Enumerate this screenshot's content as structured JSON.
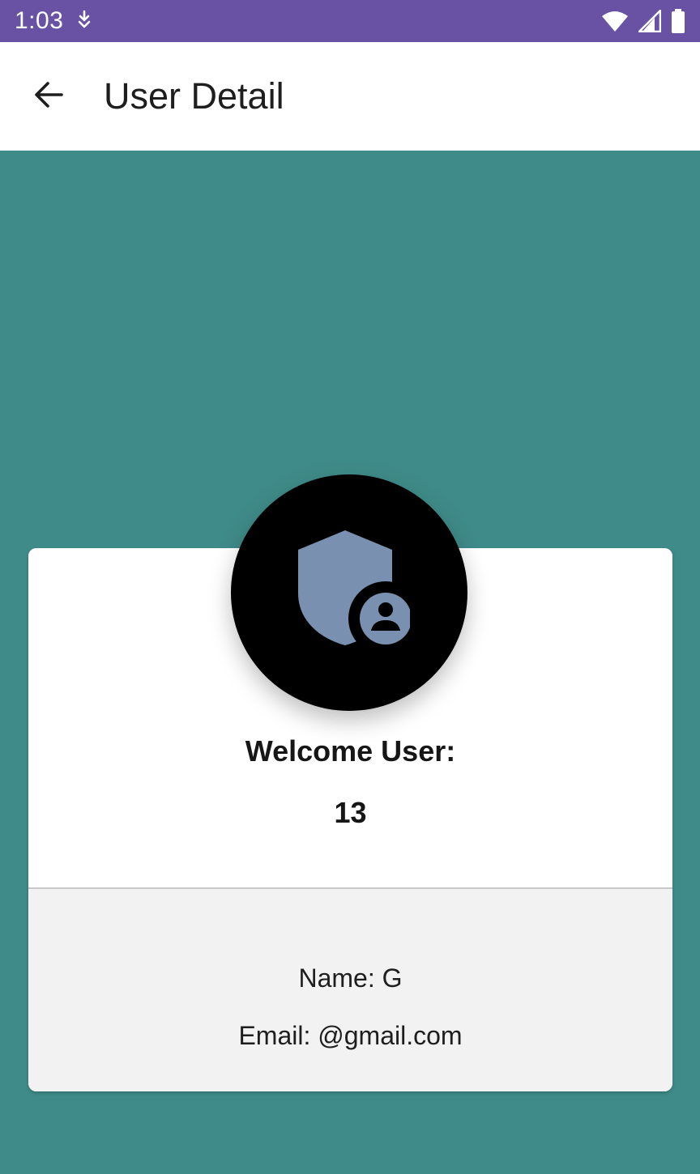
{
  "status_bar": {
    "time": "1:03",
    "background_color": "#6952a3",
    "icons": [
      "download-notification-icon",
      "wifi-icon",
      "cell-signal-icon",
      "battery-icon"
    ]
  },
  "app_bar": {
    "title": "User Detail",
    "back_icon": "arrow-back-icon"
  },
  "colors": {
    "page_background": "#3f8b89",
    "avatar_background": "#000000",
    "avatar_icon": "#7a90b0",
    "card_bottom": "#f2f2f2"
  },
  "profile": {
    "avatar_icon": "admin-shield-user-icon",
    "welcome_label": "Welcome User:",
    "user_id": "13",
    "name_line": "Name: G",
    "email_line": "Email: @gmail.com"
  }
}
